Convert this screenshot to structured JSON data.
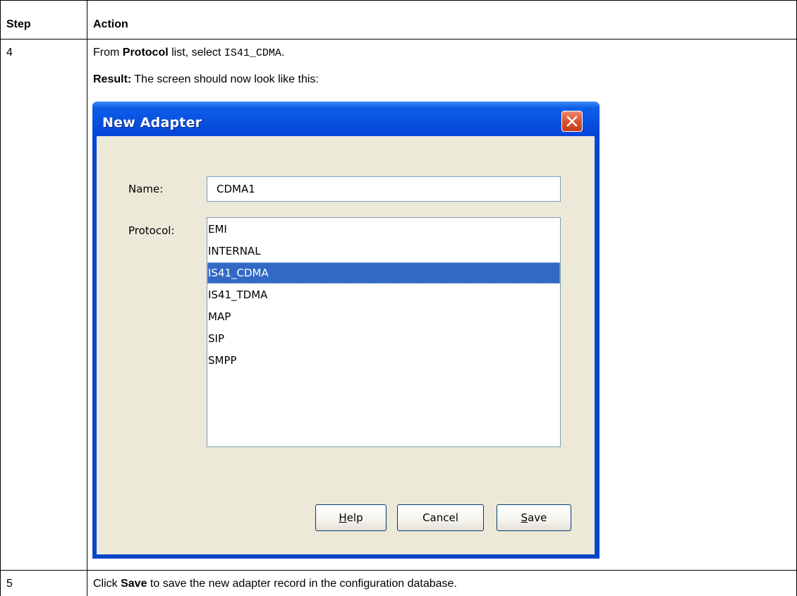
{
  "table": {
    "headers": [
      "Step",
      "Action"
    ],
    "rows": [
      {
        "step": "4",
        "line1": {
          "prefix": "From ",
          "bold": "Protocol",
          "middle": " list, select ",
          "code": "IS41_CDMA",
          "suffix": "."
        },
        "line2": {
          "bold": "Result:",
          "text": " The screen should now look like this:"
        }
      },
      {
        "step": "5",
        "line1": {
          "prefix": "Click ",
          "bold": "Save",
          "suffix": " to save the new adapter record in the configuration database."
        }
      }
    ]
  },
  "dialog": {
    "title": "New Adapter",
    "name_label": "Name:",
    "name_value": "CDMA1",
    "protocol_label": "Protocol:",
    "protocols": [
      "EMI",
      "INTERNAL",
      "IS41_CDMA",
      "IS41_TDMA",
      "MAP",
      "SIP",
      "SMPP"
    ],
    "selected_protocol": "IS41_CDMA",
    "buttons": {
      "help": {
        "mnemonic": "H",
        "rest": "elp"
      },
      "cancel": "Cancel",
      "save": {
        "mnemonic": "S",
        "rest": "ave"
      }
    },
    "colors": {
      "title_bar": "#0548d9",
      "selection": "#316ac5",
      "client": "#ece9d8",
      "close": "#d9522f"
    },
    "icons": {
      "close": "close-icon"
    }
  }
}
